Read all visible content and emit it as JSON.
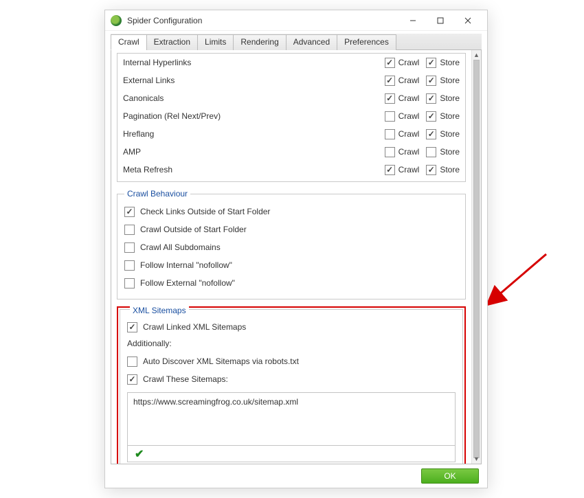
{
  "window": {
    "title": "Spider Configuration",
    "ok_label": "OK"
  },
  "tabs": [
    "Crawl",
    "Extraction",
    "Limits",
    "Rendering",
    "Advanced",
    "Preferences"
  ],
  "crawl_store_labels": {
    "crawl": "Crawl",
    "store": "Store"
  },
  "resources": [
    {
      "label": "Internal Hyperlinks",
      "crawl": true,
      "store": true
    },
    {
      "label": "External Links",
      "crawl": true,
      "store": true
    },
    {
      "label": "Canonicals",
      "crawl": true,
      "store": true
    },
    {
      "label": "Pagination (Rel Next/Prev)",
      "crawl": false,
      "store": true
    },
    {
      "label": "Hreflang",
      "crawl": false,
      "store": true
    },
    {
      "label": "AMP",
      "crawl": false,
      "store": false
    },
    {
      "label": "Meta Refresh",
      "crawl": true,
      "store": true
    }
  ],
  "crawl_behaviour": {
    "legend": "Crawl Behaviour",
    "options": [
      {
        "label": "Check Links Outside of Start Folder",
        "checked": true
      },
      {
        "label": "Crawl Outside of Start Folder",
        "checked": false
      },
      {
        "label": "Crawl All Subdomains",
        "checked": false
      },
      {
        "label": "Follow Internal \"nofollow\"",
        "checked": false
      },
      {
        "label": "Follow External \"nofollow\"",
        "checked": false
      }
    ]
  },
  "xml_sitemaps": {
    "legend": "XML Sitemaps",
    "crawl_linked": {
      "label": "Crawl Linked XML Sitemaps",
      "checked": true
    },
    "additionally": "Additionally:",
    "auto_discover": {
      "label": "Auto Discover XML Sitemaps via robots.txt",
      "checked": false
    },
    "crawl_these": {
      "label": "Crawl These Sitemaps:",
      "checked": true
    },
    "sitemap_url": "https://www.screamingfrog.co.uk/sitemap.xml"
  }
}
